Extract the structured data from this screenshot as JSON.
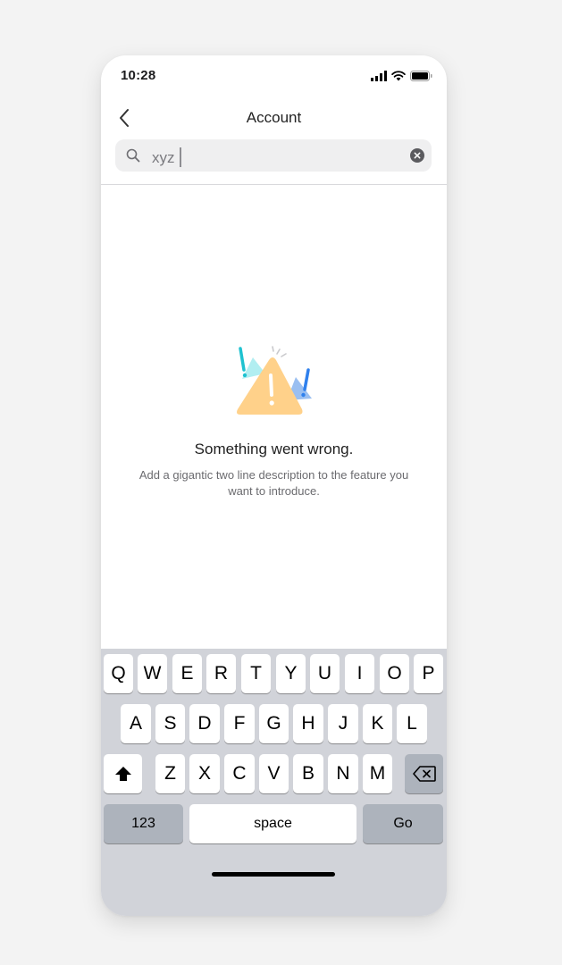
{
  "status_bar": {
    "time": "10:28"
  },
  "nav": {
    "title": "Account",
    "back_icon": "chevron-left-icon"
  },
  "search": {
    "value": "xyz",
    "icon": "search-icon",
    "clear_icon": "clear-icon"
  },
  "empty_state": {
    "title": "Something went wrong.",
    "description_line1": "Add a gigantic two line description to the feature you",
    "description_line2": "want to introduce.",
    "illustration": "warning-triangle-illustration"
  },
  "keyboard": {
    "row1": [
      "Q",
      "W",
      "E",
      "R",
      "T",
      "Y",
      "U",
      "I",
      "O",
      "P"
    ],
    "row2": [
      "A",
      "S",
      "D",
      "F",
      "G",
      "H",
      "J",
      "K",
      "L"
    ],
    "row3": [
      "Z",
      "X",
      "C",
      "V",
      "B",
      "N",
      "M"
    ],
    "numbers_label": "123",
    "space_label": "space",
    "go_label": "Go",
    "shift_icon": "shift-icon",
    "delete_icon": "backspace-icon",
    "emoji_icon": "emoji-icon",
    "mic_icon": "microphone-icon"
  },
  "colors": {
    "accent": "#2f80ed",
    "teal": "#1fc2d0",
    "warning": "#ffd18a"
  }
}
